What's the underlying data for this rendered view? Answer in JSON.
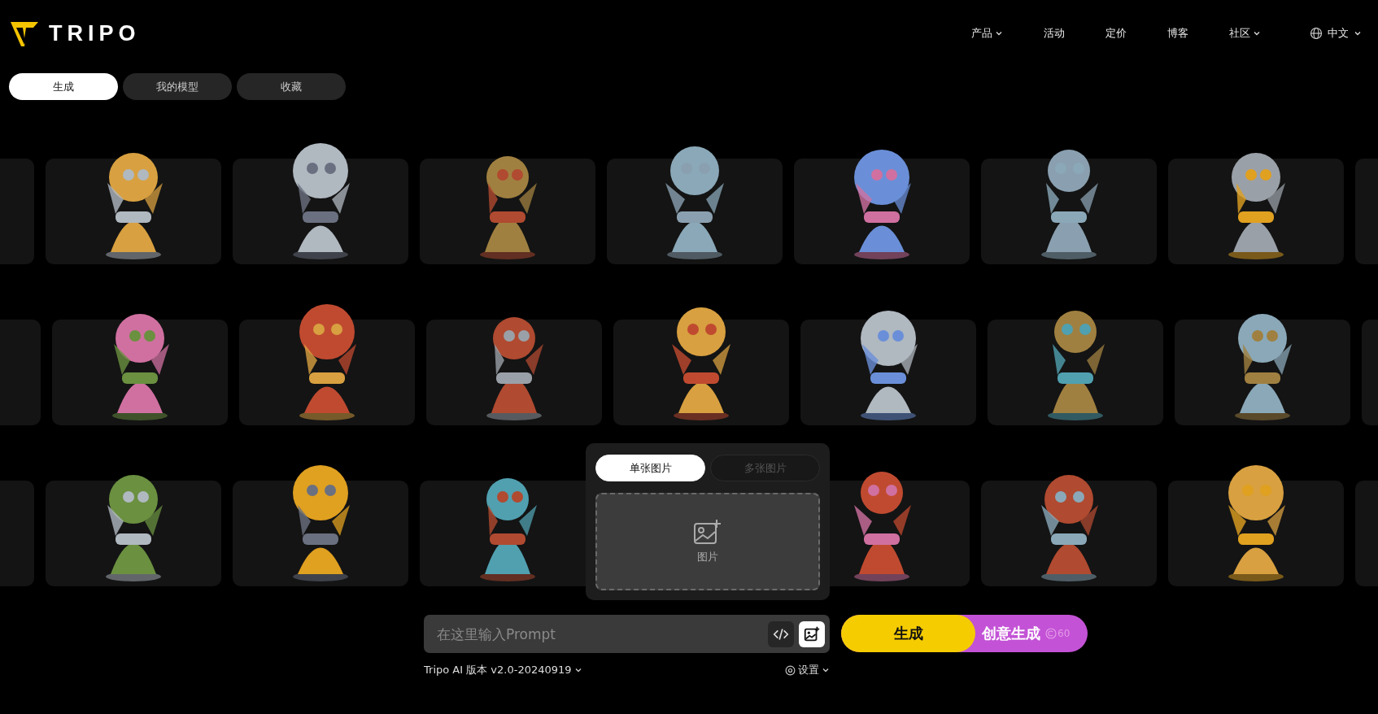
{
  "header": {
    "logo": "TRIPO",
    "nav": [
      {
        "label": "产品",
        "dropdown": true
      },
      {
        "label": "活动",
        "dropdown": false
      },
      {
        "label": "定价",
        "dropdown": false
      },
      {
        "label": "博客",
        "dropdown": false
      },
      {
        "label": "社区",
        "dropdown": true
      }
    ],
    "language": {
      "label": "中文",
      "dropdown": true
    }
  },
  "tabs": [
    {
      "label": "生成",
      "selected": true
    },
    {
      "label": "我的模型",
      "selected": false
    },
    {
      "label": "收藏",
      "selected": false
    }
  ],
  "upload_panel": {
    "modes": [
      {
        "label": "单张图片",
        "selected": true
      },
      {
        "label": "多张图片",
        "selected": false
      }
    ],
    "dropzone": {
      "label": "图片"
    }
  },
  "prompt": {
    "placeholder": "在这里输入Prompt"
  },
  "buttons": {
    "generate": "生成",
    "creative": "创意生成",
    "credits": "60"
  },
  "footer": {
    "version": "Tripo AI 版本 v2.0-20240919",
    "settings": "设置"
  }
}
